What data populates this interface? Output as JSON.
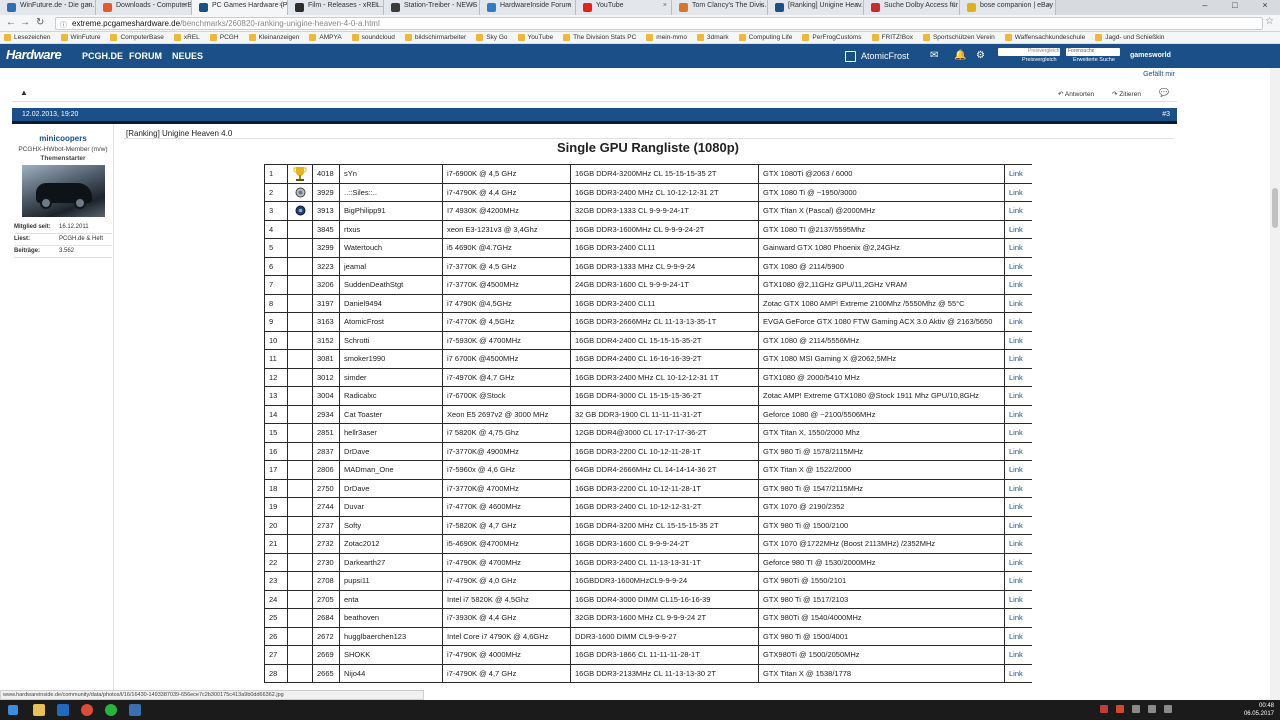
{
  "tabs": [
    {
      "label": "WinFuture.de - Die gan...",
      "color": "#2c6fb5"
    },
    {
      "label": "Downloads - ComputerB...",
      "color": "#e45b2b"
    },
    {
      "label": "PC Games Hardware (P...",
      "color": "#1b4f87"
    },
    {
      "label": "Film - Releases - xREL...",
      "color": "#2d2d2d"
    },
    {
      "label": "Station-Treiber - NEWS",
      "color": "#3b3b3b"
    },
    {
      "label": "HardwareInside Forum",
      "color": "#2e7dc8"
    },
    {
      "label": "YouTube",
      "color": "#e62117"
    },
    {
      "label": "Tom Clancy's The Divis...",
      "color": "#d8752a"
    },
    {
      "label": "[Ranking] Unigine Heav...",
      "color": "#1b4f87"
    },
    {
      "label": "Suche Dolby Access für ...",
      "color": "#c82b2b"
    },
    {
      "label": "bose companion | eBay",
      "color": "#e0b21a"
    }
  ],
  "address": {
    "host": "extreme.pcgameshardware.de",
    "path": "/benchmarks/260820-ranking-unigine-heaven-4-0-a.html"
  },
  "bookmarks": [
    "Lesezeichen",
    "WinFuture",
    "ComputerBase",
    "xREL",
    "PCGH",
    "Kleinanzeigen",
    "AMPYA",
    "soundcloud",
    "bildschirmarbeiter",
    "Sky Go",
    "YouTube",
    "The Division Stats PC",
    "mein-mmo",
    "3dmark",
    "Computing Life",
    "PerFrogCustoms",
    "FRITZ!Box",
    "Sportschützen Verein",
    "Waffensachkundeschule",
    "Jagd- und Schießkin"
  ],
  "site": {
    "logo": "Hardware",
    "nav": [
      "PCGH.DE",
      "FORUM",
      "NEUES"
    ],
    "user": "AtomicFrost",
    "search1": "Preisvergleich",
    "search2": "Forensuche",
    "sub1": "Preisvergleich",
    "sub2": "Erweiterte Suche",
    "gamesworld": "gamesworld"
  },
  "post": {
    "liked": "Gefällt mir",
    "reply": "Antworten",
    "quote": "Zitieren",
    "date": "12.02.2013, 19:20",
    "number": "#3",
    "topic": "[Ranking] Unigine Heaven 4.0",
    "heading": "Single GPU Rangliste (1080p)"
  },
  "author": {
    "name": "minicoopers",
    "role": "PCGHX-HWbot-Member (m/w)",
    "starter": "Themenstarter",
    "stats": [
      {
        "k": "Mitglied seit:",
        "v": "16.12.2011"
      },
      {
        "k": "Liest:",
        "v": "PCGH.de & Heft"
      },
      {
        "k": "Beiträge:",
        "v": "3.562"
      }
    ]
  },
  "ranking": [
    {
      "rank": "1",
      "score": "4018",
      "user": "sYn",
      "cpu": "i7-6900K @ 4,5 GHz",
      "ram": "16GB DDR4-3200MHz CL 15-15-15-35 2T",
      "gpu": "GTX 1080Ti @2063 / 6000",
      "link": "Link",
      "icon": "gold"
    },
    {
      "rank": "2",
      "score": "3929",
      "user": "..::Siles::..",
      "cpu": "i7-4790K @ 4,4 GHz",
      "ram": "16GB DDR3-2400 MHz CL 10-12-12-31 2T",
      "gpu": "GTX 1080 Ti @ ~1950/3000",
      "link": "Link",
      "icon": "silver"
    },
    {
      "rank": "3",
      "score": "3913",
      "user": "BigPhilipp91",
      "cpu": "I7 4930K @4200MHz",
      "ram": "32GB DDR3-1333 CL 9-9-9-24-1T",
      "gpu": "GTX Titan X (Pascal) @2000MHz",
      "link": "Link",
      "icon": "bronze"
    },
    {
      "rank": "4",
      "score": "3845",
      "user": "rtxus",
      "cpu": "xeon E3-1231v3 @ 3,4Ghz",
      "ram": "16GB DDR3-1600MHz CL 9-9-9-24-2T",
      "gpu": "GTX 1080 TI @2137/5595Mhz",
      "link": "Link",
      "icon": ""
    },
    {
      "rank": "5",
      "score": "3299",
      "user": "Watertouch",
      "cpu": "i5 4690K @4.7GHz",
      "ram": "16GB DDR3-2400 CL11",
      "gpu": "Gainward GTX 1080 Phoenix @2,24GHz",
      "link": "Link",
      "icon": ""
    },
    {
      "rank": "6",
      "score": "3223",
      "user": "jeamal",
      "cpu": "i7-3770K @ 4,5 GHz",
      "ram": "16GB DDR3-1333 MHz CL 9-9-9-24",
      "gpu": "GTX 1080 @ 2114/5900",
      "link": "Link",
      "icon": ""
    },
    {
      "rank": "7",
      "score": "3206",
      "user": "SuddenDeathStgt",
      "cpu": "i7-3770K @4500MHz",
      "ram": "24GB DDR3-1600 CL 9-9-9-24-1T",
      "gpu": "GTX1080 @2,11GHz GPU/11,2GHz VRAM",
      "link": "Link",
      "icon": ""
    },
    {
      "rank": "8",
      "score": "3197",
      "user": "Daniel9494",
      "cpu": "i7 4790K @4,5GHz",
      "ram": "16GB DDR3-2400 CL11",
      "gpu": "Zotac GTX 1080 AMP! Extreme 2100Mhz /5550Mhz @ 55°C",
      "link": "Link",
      "icon": ""
    },
    {
      "rank": "9",
      "score": "3163",
      "user": "AtomicFrost",
      "cpu": "i7-4770K @ 4,5GHz",
      "ram": "16GB DDR3-2666MHz CL 11-13-13-35-1T",
      "gpu": "EVGA GeForce GTX 1080 FTW Gaming ACX 3.0 Aktiv @ 2163/5650",
      "link": "Link",
      "icon": ""
    },
    {
      "rank": "10",
      "score": "3152",
      "user": "Schrotti",
      "cpu": "i7-5930K @ 4700MHz",
      "ram": "16GB DDR4-2400 CL 15-15-15-35-2T",
      "gpu": "GTX 1080 @ 2114/5556MHz",
      "link": "Link",
      "icon": ""
    },
    {
      "rank": "11",
      "score": "3081",
      "user": "smoker1990",
      "cpu": "i7 6700K @4500MHz",
      "ram": "16GB DDR4-2400 CL 16-16-16-39-2T",
      "gpu": "GTX 1080 MSI Gaming X @2062,5MHz",
      "link": "Link",
      "icon": ""
    },
    {
      "rank": "12",
      "score": "3012",
      "user": "simder",
      "cpu": "i7-4970K @4,7 GHz",
      "ram": "16GB DDR3-2400 MHz CL 10-12-12-31 1T",
      "gpu": "GTX1080 @ 2000/5410 MHz",
      "link": "Link",
      "icon": ""
    },
    {
      "rank": "13",
      "score": "3004",
      "user": "Radicalxc",
      "cpu": "i7-6700K @Stock",
      "ram": "16GB DDR4-3000 CL 15-15-15-36-2T",
      "gpu": "Zotac AMP! Extreme GTX1080 @Stock 1911 Mhz GPU/10,8GHz",
      "link": "Link",
      "icon": ""
    },
    {
      "rank": "14",
      "score": "2934",
      "user": "Cat Toaster",
      "cpu": "Xeon E5 2697v2 @ 3000 MHz",
      "ram": "32 GB DDR3-1900 CL 11-11-11-31-2T",
      "gpu": "Geforce 1080 @ ~2100/5506MHz",
      "link": "Link",
      "icon": ""
    },
    {
      "rank": "15",
      "score": "2851",
      "user": "hellr3aser",
      "cpu": "i7 5820K @ 4,75 Ghz",
      "ram": "12GB DDR4@3000 CL 17-17-17-36-2T",
      "gpu": "GTX Titan X, 1550/2000 Mhz",
      "link": "Link",
      "icon": ""
    },
    {
      "rank": "16",
      "score": "2837",
      "user": "DrDave",
      "cpu": "i7-3770K@ 4900MHz",
      "ram": "16GB DDR3-2200 CL 10-12-11-28-1T",
      "gpu": "GTX 980 Ti @ 1578/2115MHz",
      "link": "Link",
      "icon": ""
    },
    {
      "rank": "17",
      "score": "2806",
      "user": "MADman_One",
      "cpu": "i7-5960x @ 4,6 GHz",
      "ram": "64GB DDR4-2666MHz CL 14-14-14-36 2T",
      "gpu": "GTX Titan X @ 1522/2000",
      "link": "Link",
      "icon": ""
    },
    {
      "rank": "18",
      "score": "2750",
      "user": "DrDave",
      "cpu": "i7-3770K@ 4700MHz",
      "ram": "16GB DDR3-2200 CL 10-12-11-28-1T",
      "gpu": "GTX 980 Ti @ 1547/2115MHz",
      "link": "Link",
      "icon": ""
    },
    {
      "rank": "19",
      "score": "2744",
      "user": "Duvar",
      "cpu": "i7-4770K @ 4600MHz",
      "ram": "16GB DDR3-2400 CL 10-12-12-31-2T",
      "gpu": "GTX 1070 @ 2190/2352",
      "link": "Link",
      "icon": ""
    },
    {
      "rank": "20",
      "score": "2737",
      "user": "Softy",
      "cpu": "i7-5820K @ 4,7 GHz",
      "ram": "16GB DDR4-3200 MHz CL 15-15-15-35 2T",
      "gpu": "GTX 980 Ti @ 1500/2100",
      "link": "Link",
      "icon": ""
    },
    {
      "rank": "21",
      "score": "2732",
      "user": "Zotac2012",
      "cpu": "i5-4690K @4700MHz",
      "ram": "16GB DDR3-1600 CL 9-9-9-24-2T",
      "gpu": "GTX 1070 @1722MHz (Boost 2113MHz) /2352MHz",
      "link": "Link",
      "icon": ""
    },
    {
      "rank": "22",
      "score": "2730",
      "user": "Darkearth27",
      "cpu": "i7-4790K @ 4700MHz",
      "ram": "16GB DDR3-2400 CL 11-13-13-31-1T",
      "gpu": "Geforce 980 TI @ 1530/2000MHz",
      "link": "Link",
      "icon": ""
    },
    {
      "rank": "23",
      "score": "2708",
      "user": "pupsi11",
      "cpu": "i7-4790K @ 4,0 GHz",
      "ram": "16GBDDR3-1600MHzCL9-9-9-24",
      "gpu": "GTX 980Ti @ 1550/2101",
      "link": "Link",
      "icon": ""
    },
    {
      "rank": "24",
      "score": "2705",
      "user": "enta",
      "cpu": "Intel i7 5820K @ 4,5Ghz",
      "ram": "16GB DDR4-3000 DIMM CL15-16-16-39",
      "gpu": "GTX 980 Ti @ 1517/2103",
      "link": "Link",
      "icon": ""
    },
    {
      "rank": "25",
      "score": "2684",
      "user": "beathoven",
      "cpu": "i7-3930K @ 4,4 GHz",
      "ram": "32GB DDR3-1600 MHz CL 9-9-9-24 2T",
      "gpu": "GTX 980Ti @ 1540/4000MHz",
      "link": "Link",
      "icon": ""
    },
    {
      "rank": "26",
      "score": "2672",
      "user": "hugglbaerchen123",
      "cpu": "Intel Core i7 4790K @ 4,6GHz",
      "ram": "DDR3-1600 DIMM CL9-9-9-27",
      "gpu": "GTX 980 Ti @ 1500/4001",
      "link": "Link",
      "icon": ""
    },
    {
      "rank": "27",
      "score": "2669",
      "user": "SHOKK",
      "cpu": "i7-4790K @ 4000MHz",
      "ram": "16GB DDR3-1866 CL 11-11-11-28-1T",
      "gpu": "GTX980Ti @ 1500/2050MHz",
      "link": "Link",
      "icon": ""
    },
    {
      "rank": "28",
      "score": "2665",
      "user": "Nijo44",
      "cpu": "i7-4790K @ 4,7 GHz",
      "ram": "16GB DDR3-2133MHz CL 11-13-13-30 2T",
      "gpu": "GTX Titan X @ 1538/1778",
      "link": "Link",
      "icon": ""
    }
  ],
  "status_url": "www.hardwareinside.de/community/data/photos/l/16/16430-1493387039-656ece7c2b300175c413a9b0dd66362.jpg",
  "tray": {
    "time": "00:48",
    "date": "06.05.2017"
  }
}
